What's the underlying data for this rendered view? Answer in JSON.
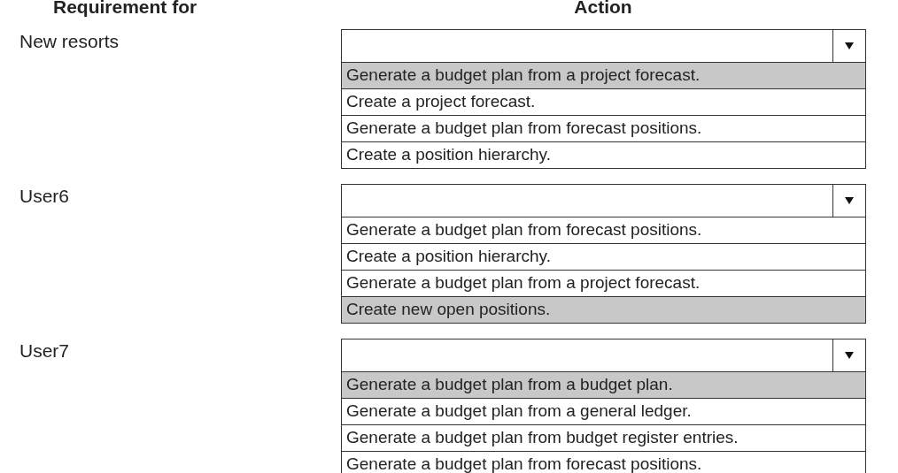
{
  "headers": {
    "requirement": "Requirement for",
    "action": "Action"
  },
  "groups": [
    {
      "requirement": "New resorts",
      "options": [
        {
          "text": "Generate a budget plan from a project forecast.",
          "selected": true
        },
        {
          "text": "Create a project forecast.",
          "selected": false
        },
        {
          "text": "Generate a budget plan from forecast positions.",
          "selected": false
        },
        {
          "text": "Create a position hierarchy.",
          "selected": false
        }
      ]
    },
    {
      "requirement": "User6",
      "options": [
        {
          "text": "Generate a budget plan from forecast positions.",
          "selected": false
        },
        {
          "text": "Create a position hierarchy.",
          "selected": false
        },
        {
          "text": "Generate a budget plan from a project forecast.",
          "selected": false
        },
        {
          "text": "Create new open positions.",
          "selected": true
        }
      ]
    },
    {
      "requirement": "User7",
      "options": [
        {
          "text": "Generate a budget plan from a budget plan.",
          "selected": true
        },
        {
          "text": "Generate a budget plan from a general ledger.",
          "selected": false
        },
        {
          "text": "Generate a budget plan from budget register entries.",
          "selected": false
        },
        {
          "text": "Generate a budget plan from forecast positions.",
          "selected": false
        }
      ]
    }
  ]
}
